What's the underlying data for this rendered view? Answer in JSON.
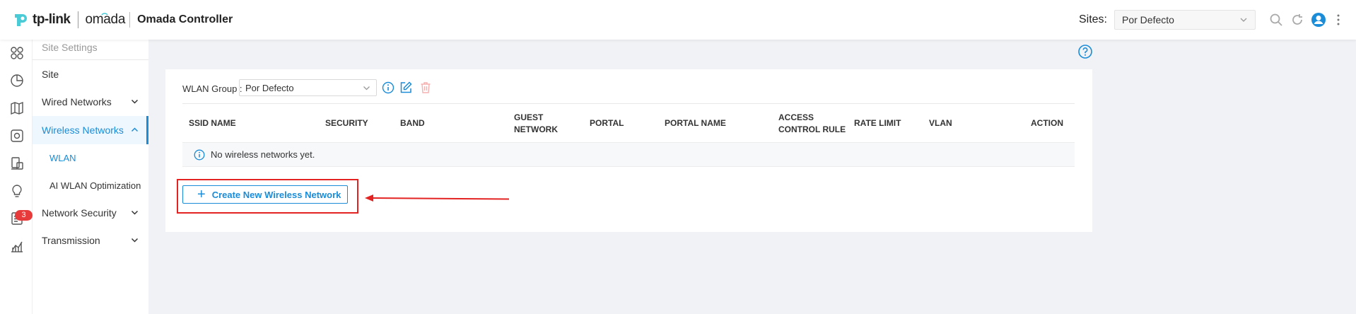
{
  "header": {
    "brand": "tp-link",
    "product": "omada",
    "app_title": "Omada Controller",
    "sites_label": "Sites:",
    "sites_value": "Por Defecto"
  },
  "rail": {
    "icons": [
      "dashboard-icon",
      "statistics-icon",
      "map-icon",
      "devices-icon",
      "clients-icon",
      "insights-icon",
      "logs-icon",
      "reports-icon"
    ],
    "logs_badge": "3"
  },
  "sidebar": {
    "header": "Site Settings",
    "items": [
      {
        "label": "Site"
      },
      {
        "label": "Wired Networks"
      },
      {
        "label": "Wireless Networks"
      },
      {
        "label": "WLAN"
      },
      {
        "label": "AI WLAN Optimization"
      },
      {
        "label": "Network Security"
      },
      {
        "label": "Transmission"
      }
    ]
  },
  "main": {
    "wlan_group_label": "WLAN Group :",
    "wlan_group_value": "Por Defecto",
    "columns": [
      "SSID NAME",
      "SECURITY",
      "BAND",
      "GUEST NETWORK",
      "PORTAL",
      "PORTAL NAME",
      "ACCESS CONTROL RULE",
      "RATE LIMIT",
      "VLAN",
      "ACTION"
    ],
    "empty_message": "No wireless networks yet.",
    "create_button": "Create New Wireless Network"
  },
  "colors": {
    "accent": "#1a8cd8",
    "highlight": "#e32222",
    "badge": "#e73b3b"
  }
}
